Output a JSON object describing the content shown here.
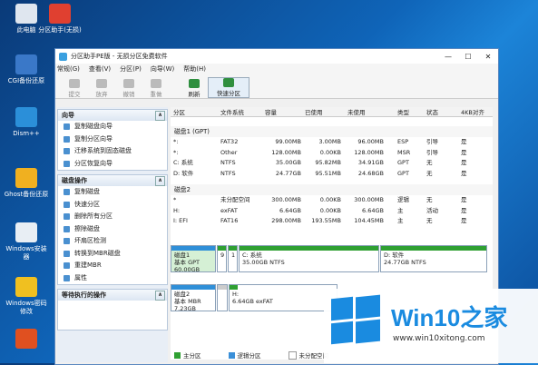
{
  "desktop": {
    "icons": [
      {
        "label": "此电脑",
        "color": "#dfe6ef"
      },
      {
        "label": "分区助手(无损)",
        "color": "#e04030"
      },
      {
        "label": "CGI备份还原",
        "color": "#3a78c8"
      },
      {
        "label": "Dism++",
        "color": "#2b8fd9"
      },
      {
        "label": "Ghost备份还原",
        "color": "#f0b020"
      },
      {
        "label": "Windows安装器",
        "color": "#e8eef4"
      },
      {
        "label": "Windows密码修改",
        "color": "#f0c020"
      },
      {
        "label": "",
        "color": "#e05020"
      }
    ]
  },
  "window": {
    "title": "分区助手PE版 - 无损分区免费软件",
    "controls": [
      "—",
      "☐",
      "✕"
    ],
    "menu": [
      "常规(G)",
      "查看(V)",
      "分区(P)",
      "向导(W)",
      "帮助(H)"
    ],
    "toolbar": [
      {
        "label": "提交",
        "active": false
      },
      {
        "label": "放弃",
        "active": false
      },
      {
        "label": "撤销",
        "active": false
      },
      {
        "label": "重做",
        "active": false
      },
      {
        "label": "刷新",
        "active": true
      },
      {
        "label": "快速分区",
        "active": true
      }
    ],
    "wizard": {
      "title": "向导",
      "collapse": "∧",
      "items": [
        "复制磁盘向导",
        "复制分区向导",
        "迁移系统到固态磁盘",
        "分区恢复向导"
      ]
    },
    "diskops": {
      "title": "磁盘操作",
      "collapse": "∧",
      "items": [
        "复制磁盘",
        "快速分区",
        "删除所有分区",
        "擦除磁盘",
        "坏扇区检测",
        "转换到MBR磁盘",
        "重建MBR",
        "属性"
      ]
    },
    "pending": {
      "title": "等待执行的操作",
      "collapse": "∧"
    },
    "table": {
      "headers": [
        "分区",
        "文件系统",
        "容量",
        "已使用",
        "未使用",
        "类型",
        "状态",
        "4KB对齐"
      ],
      "disks": [
        {
          "title": "磁盘1 (GPT)",
          "rows": [
            [
              "*:",
              "FAT32",
              "99.00MB",
              "3.00MB",
              "96.00MB",
              "ESP",
              "引导",
              "是"
            ],
            [
              "*:",
              "Other",
              "128.00MB",
              "0.00KB",
              "128.00MB",
              "MSR",
              "引导",
              "是"
            ],
            [
              "C: 系统",
              "NTFS",
              "35.00GB",
              "95.82MB",
              "34.91GB",
              "GPT",
              "无",
              "是"
            ],
            [
              "D: 软件",
              "NTFS",
              "24.77GB",
              "95.51MB",
              "24.68GB",
              "GPT",
              "无",
              "是"
            ]
          ]
        },
        {
          "title": "磁盘2",
          "rows": [
            [
              "*",
              "未分配空间",
              "300.00MB",
              "0.00KB",
              "300.00MB",
              "逻辑",
              "无",
              "是"
            ],
            [
              "H:",
              "exFAT",
              "6.64GB",
              "0.00KB",
              "6.64GB",
              "主",
              "活动",
              "是"
            ],
            [
              "I: EFI",
              "FAT16",
              "298.00MB",
              "193.55MB",
              "104.45MB",
              "主",
              "无",
              "是"
            ]
          ]
        }
      ]
    },
    "map": {
      "disk1": {
        "name": "磁盘1",
        "info": "基本 GPT",
        "size": "60.00GB",
        "p1": "9",
        "p2": "1",
        "c_name": "C: 系统",
        "c_info": "35.00GB NTFS",
        "d_name": "D: 软件",
        "d_info": "24.77GB NTFS"
      },
      "disk2": {
        "name": "磁盘2",
        "info": "基本 MBR",
        "size": "7.23GB",
        "h_name": "H:",
        "h_info": "6.64GB exFAT"
      }
    },
    "legend": [
      "主分区",
      "逻辑分区",
      "未分配空间"
    ]
  },
  "logo": {
    "brand": "Win10",
    "suffix": "之家",
    "url": "www.win10xitong.com",
    "accent": "#1a8be0"
  }
}
